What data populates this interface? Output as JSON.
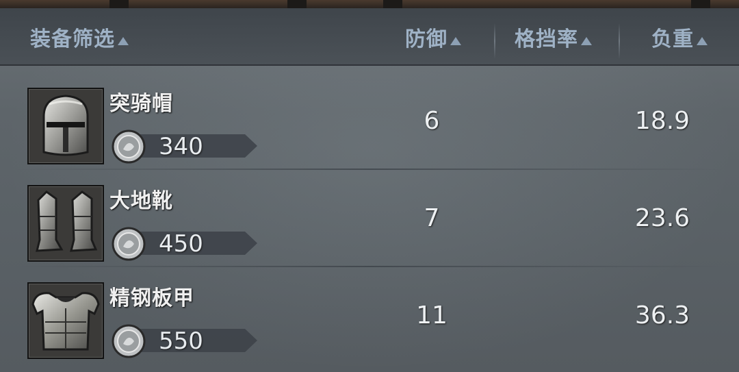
{
  "header": {
    "filter_label": "装备筛选",
    "defense_label": "防御",
    "block_label": "格挡率",
    "weight_label": "负重"
  },
  "items": [
    {
      "name": "突骑帽",
      "price": "340",
      "defense": "6",
      "block": "",
      "weight": "18.9",
      "icon": "helmet-icon"
    },
    {
      "name": "大地靴",
      "price": "450",
      "defense": "7",
      "block": "",
      "weight": "23.6",
      "icon": "boots-icon"
    },
    {
      "name": "精钢板甲",
      "price": "550",
      "defense": "11",
      "block": "",
      "weight": "36.3",
      "icon": "plate-armor-icon"
    }
  ],
  "currency_icon": "silver-coin-icon",
  "colors": {
    "header_text": "#9fb2c6",
    "value_text": "#edf0f2"
  }
}
